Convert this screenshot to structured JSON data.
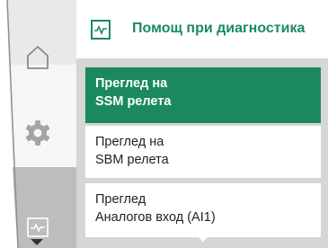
{
  "header": {
    "title": "Помощ при диагностика",
    "icon": "diagnostics-icon",
    "accent": "#1a8a5e"
  },
  "rail": {
    "items": [
      {
        "icon": "home-icon"
      },
      {
        "icon": "gear-icon"
      },
      {
        "icon": "diagnostics-icon"
      }
    ]
  },
  "menu": {
    "items": [
      {
        "line1": "Преглед на",
        "line2": "SSM релета",
        "selected": true
      },
      {
        "line1": "Преглед на",
        "line2": "SBM релета",
        "selected": false
      },
      {
        "line1": "Преглед",
        "line2": "Аналогов вход (AI1)",
        "selected": false
      }
    ]
  },
  "colors": {
    "accent": "#1a8a5e",
    "menu_background": "#d6d6d6",
    "rail_light": "#e9e9e9",
    "rail_dark": "#bfbfbf"
  }
}
